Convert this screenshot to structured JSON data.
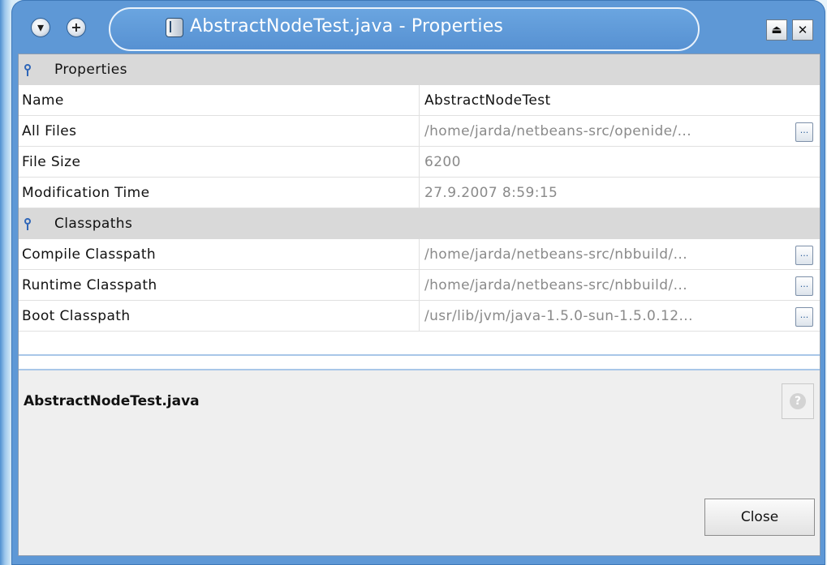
{
  "window": {
    "title": "AbstractNodeTest.java - Properties"
  },
  "sheet": {
    "categories": [
      {
        "label": "Properties",
        "rows": [
          {
            "name": "Name",
            "value": "AbstractNodeTest",
            "editable": true
          },
          {
            "name": "All Files",
            "value": "/home/jarda/netbeans-src/openide/...",
            "editable": false,
            "has_button": true
          },
          {
            "name": "File Size",
            "value": "6200",
            "editable": false
          },
          {
            "name": "Modification Time",
            "value": "27.9.2007 8:59:15",
            "editable": false
          }
        ]
      },
      {
        "label": "Classpaths",
        "rows": [
          {
            "name": "Compile Classpath",
            "value": "/home/jarda/netbeans-src/nbbuild/...",
            "editable": false,
            "has_button": true
          },
          {
            "name": "Runtime Classpath",
            "value": "/home/jarda/netbeans-src/nbbuild/...",
            "editable": false,
            "has_button": true
          },
          {
            "name": "Boot Classpath",
            "value": "/usr/lib/jvm/java-1.5.0-sun-1.5.0.12...",
            "editable": false,
            "has_button": true
          }
        ]
      }
    ],
    "ellipsis_label": "..."
  },
  "description": {
    "title": "AbstractNodeTest.java"
  },
  "help": {
    "label": "?"
  },
  "buttons": {
    "close": "Close"
  },
  "colors": {
    "frame": "#5e98d6",
    "category_bg": "#d9d9d9",
    "readonly_text": "#8a8a8a"
  }
}
